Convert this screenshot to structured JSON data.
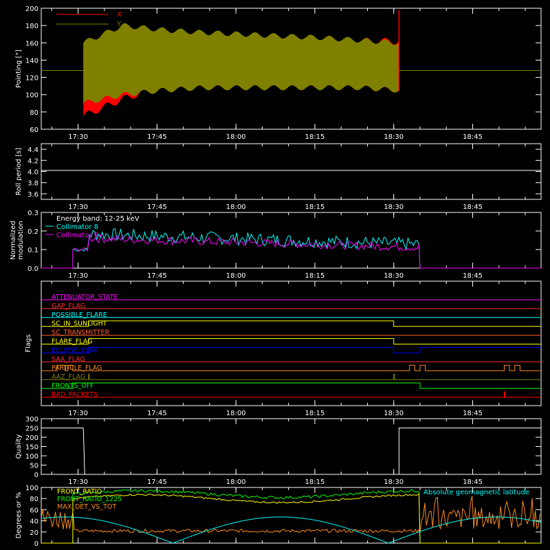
{
  "colors": {
    "bg": "#000000",
    "axis": "#ffffff",
    "x_red": "#ff0000",
    "y_olive": "#808000",
    "cyan": "#00ffff",
    "magenta": "#ff00ff",
    "white": "#ffffff",
    "green": "#00ff00",
    "yellow": "#ffff00",
    "orange": "#ff8c1a"
  },
  "x_axis": {
    "ticks": [
      "17:30",
      "17:45",
      "18:00",
      "18:15",
      "18:30",
      "18:45"
    ]
  },
  "chart_data": [
    {
      "type": "area",
      "id": "pointing",
      "ylabel": "Pointing [\"]",
      "ylim": [
        60,
        200
      ],
      "yticks": [
        60,
        80,
        100,
        120,
        140,
        160,
        180,
        200
      ],
      "legend": [
        "X",
        "Y"
      ],
      "series": [
        {
          "name": "X",
          "upper": [
            155,
            175,
            170,
            168,
            166,
            165,
            163,
            162,
            162
          ],
          "lower": [
            75,
            95,
            110,
            115,
            117,
            118,
            115,
            112,
            108
          ]
        },
        {
          "name": "Y",
          "upper": [
            160,
            180,
            175,
            172,
            170,
            168,
            166,
            163,
            160
          ],
          "lower": [
            90,
            100,
            105,
            108,
            108,
            108,
            108,
            108,
            105
          ]
        }
      ],
      "reference_line": 128
    },
    {
      "type": "line",
      "id": "roll",
      "ylabel": "Roll period [s]",
      "ylim": [
        3.5,
        4.5
      ],
      "yticks": [
        "3.6",
        "3.8",
        "4.0",
        "4.2",
        "4.4"
      ],
      "values": [
        4.02
      ]
    },
    {
      "type": "line",
      "id": "modulation",
      "ylabel": [
        "Normalized",
        "modulation"
      ],
      "ylim": [
        0,
        0.3
      ],
      "yticks": [
        "0.0",
        "0.1",
        "0.2",
        "0.3"
      ],
      "legend": [
        "Energy band: 12-25 keV",
        "Collimator 8",
        "Collimator 9"
      ],
      "series": [
        {
          "name": "Collimator 8",
          "baseline": 0.16
        },
        {
          "name": "Collimator 9",
          "baseline": 0.14
        }
      ]
    },
    {
      "type": "step",
      "id": "flags",
      "ylabel": "Flags",
      "flags": [
        {
          "name": "ATTENUATOR_STATE",
          "color": "#ff00ff"
        },
        {
          "name": "GAP_FLAG",
          "color": "#ff3030"
        },
        {
          "name": "POSSIBLE_FLARE",
          "color": "#00ffff"
        },
        {
          "name": "SC_IN_SUNLIGHT",
          "color": "#ffff00"
        },
        {
          "name": "SC_TRANSMITTER",
          "color": "#ff6030"
        },
        {
          "name": "FLARE_FLAG",
          "color": "#ffff00"
        },
        {
          "name": "ECLIPSE_FLAG",
          "color": "#0000ff"
        },
        {
          "name": "SAA_FLAG",
          "color": "#ff3030"
        },
        {
          "name": "PARTICLE_FLAG",
          "color": "#ff8c1a"
        },
        {
          "name": "AAZ_FLAG",
          "color": "#808000"
        },
        {
          "name": "FRONTS_OFF",
          "color": "#00ff00"
        },
        {
          "name": "BAD_PACKETS",
          "color": "#ff0000"
        }
      ]
    },
    {
      "type": "line",
      "id": "quality",
      "ylabel": "Quality",
      "ylim": [
        0,
        300
      ],
      "yticks": [
        0,
        50,
        100,
        150,
        200,
        250,
        300
      ],
      "values": [
        250,
        0,
        250
      ]
    },
    {
      "type": "line",
      "id": "ratios",
      "ylabel": "Degrees or %",
      "ylim": [
        0,
        100
      ],
      "yticks": [
        0,
        20,
        40,
        60,
        80,
        100
      ],
      "legend": [
        "FRONT_RATIO",
        "FRONT_RATIO_1225",
        "MAX_DET_VS_TOT",
        "Absolute geomagnetic latitude"
      ],
      "series": [
        {
          "name": "FRONT_RATIO",
          "level": 80
        },
        {
          "name": "FRONT_RATIO_1225",
          "level": 88
        },
        {
          "name": "MAX_DET_VS_TOT",
          "level": 22
        },
        {
          "name": "Absolute geomagnetic latitude",
          "max": 47
        }
      ]
    }
  ]
}
